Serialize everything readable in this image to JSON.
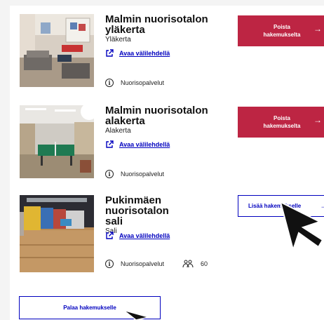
{
  "rooms": [
    {
      "title_line1": "Malmin nuorisotalon",
      "title_line2": "yläkerta",
      "subtitle": "Yläkerta",
      "link_label": "Avaa välilehdellä",
      "provider": "Nuorisopalvelut",
      "action_label": "Poista hakemukselta",
      "action_type": "remove"
    },
    {
      "title_line1": "Malmin nuorisotalon",
      "title_line2": "alakerta",
      "subtitle": "Alakerta",
      "link_label": "Avaa välilehdellä",
      "provider": "Nuorisopalvelut",
      "action_label": "Poista hakemukselta",
      "action_type": "remove"
    },
    {
      "title_line1": "Pukinmäen nuorisotalon",
      "title_line2": "sali",
      "subtitle": "Sali",
      "link_label": "Avaa välilehdellä",
      "provider": "Nuorisopalvelut",
      "capacity": "60",
      "action_label": "Lisää hakemukselle",
      "action_type": "add"
    }
  ],
  "back_button_label": "Palaa hakemukselle",
  "icons": {
    "link": "external-link-icon",
    "info": "info-icon",
    "people": "people-icon",
    "arrow": "arrow-right-icon"
  },
  "colors": {
    "remove_bg": "#bd2543",
    "link": "#0000bf"
  }
}
